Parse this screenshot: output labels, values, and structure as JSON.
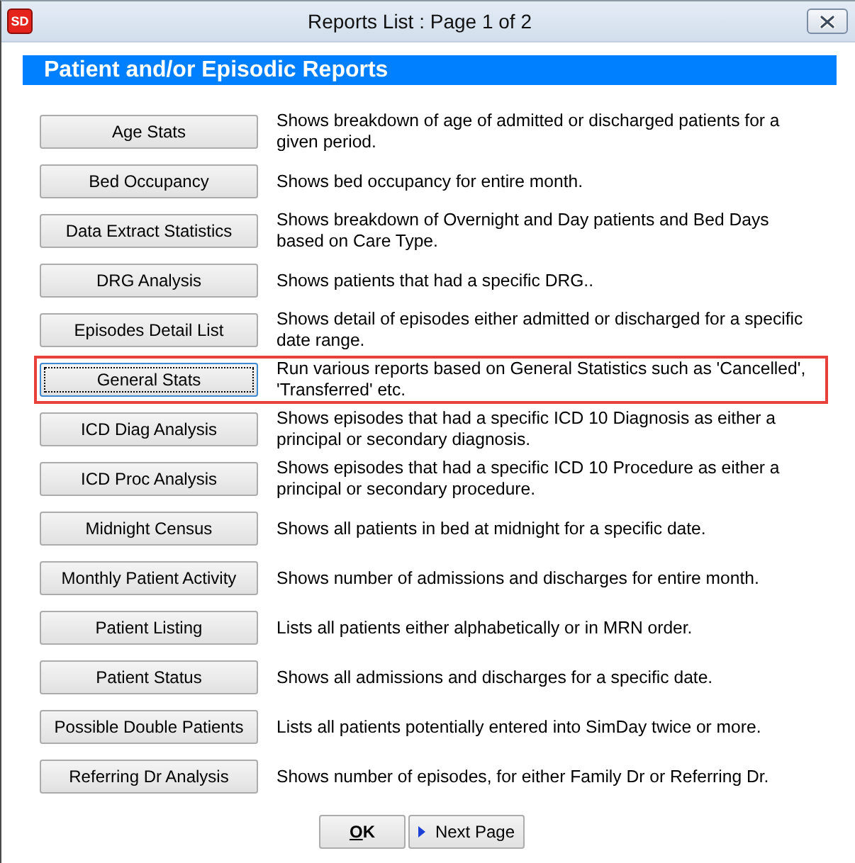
{
  "window": {
    "icon_text": "SD",
    "title": "Reports List : Page 1 of 2"
  },
  "section": {
    "title": "Patient and/or Episodic Reports"
  },
  "reports": [
    {
      "label": "Age Stats",
      "description": "Shows breakdown of age of admitted or discharged patients for a given period.",
      "focused": false,
      "highlighted": false
    },
    {
      "label": "Bed Occupancy",
      "description": "Shows bed occupancy for entire month.",
      "focused": false,
      "highlighted": false
    },
    {
      "label": "Data Extract Statistics",
      "description": "Shows breakdown of Overnight and Day patients and Bed Days based on Care Type.",
      "focused": false,
      "highlighted": false
    },
    {
      "label": "DRG Analysis",
      "description": "Shows patients that had a specific DRG..",
      "focused": false,
      "highlighted": false
    },
    {
      "label": "Episodes Detail List",
      "description": "Shows detail of episodes either admitted or discharged for a specific date range.",
      "focused": false,
      "highlighted": false
    },
    {
      "label": "General Stats",
      "description": "Run various reports based on General Statistics such as 'Cancelled', 'Transferred' etc.",
      "focused": true,
      "highlighted": true
    },
    {
      "label": "ICD Diag Analysis",
      "description": "Shows episodes that had a specific ICD 10 Diagnosis as either a principal or secondary diagnosis.",
      "focused": false,
      "highlighted": false
    },
    {
      "label": "ICD Proc Analysis",
      "description": "Shows episodes that had a specific ICD 10 Procedure as either a principal or secondary procedure.",
      "focused": false,
      "highlighted": false
    },
    {
      "label": "Midnight Census",
      "description": "Shows all patients in bed at midnight for a specific date.",
      "focused": false,
      "highlighted": false
    },
    {
      "label": "Monthly Patient Activity",
      "description": "Shows number of admissions and discharges for entire month.",
      "focused": false,
      "highlighted": false
    },
    {
      "label": "Patient Listing",
      "description": "Lists all patients either alphabetically or in MRN order.",
      "focused": false,
      "highlighted": false
    },
    {
      "label": "Patient Status",
      "description": "Shows all admissions and discharges for a specific date.",
      "focused": false,
      "highlighted": false
    },
    {
      "label": "Possible Double Patients",
      "description": "Lists all patients potentially entered into SimDay twice or more.",
      "focused": false,
      "highlighted": false
    },
    {
      "label": "Referring Dr Analysis",
      "description": "Shows number of episodes, for either Family Dr or Referring Dr.",
      "focused": false,
      "highlighted": false
    }
  ],
  "buttons": [
    {
      "label": "OK",
      "kind": "ok",
      "default": true,
      "mnemonic": true
    },
    {
      "label": "Next Page",
      "kind": "next",
      "default": false,
      "mnemonic": false
    }
  ]
}
